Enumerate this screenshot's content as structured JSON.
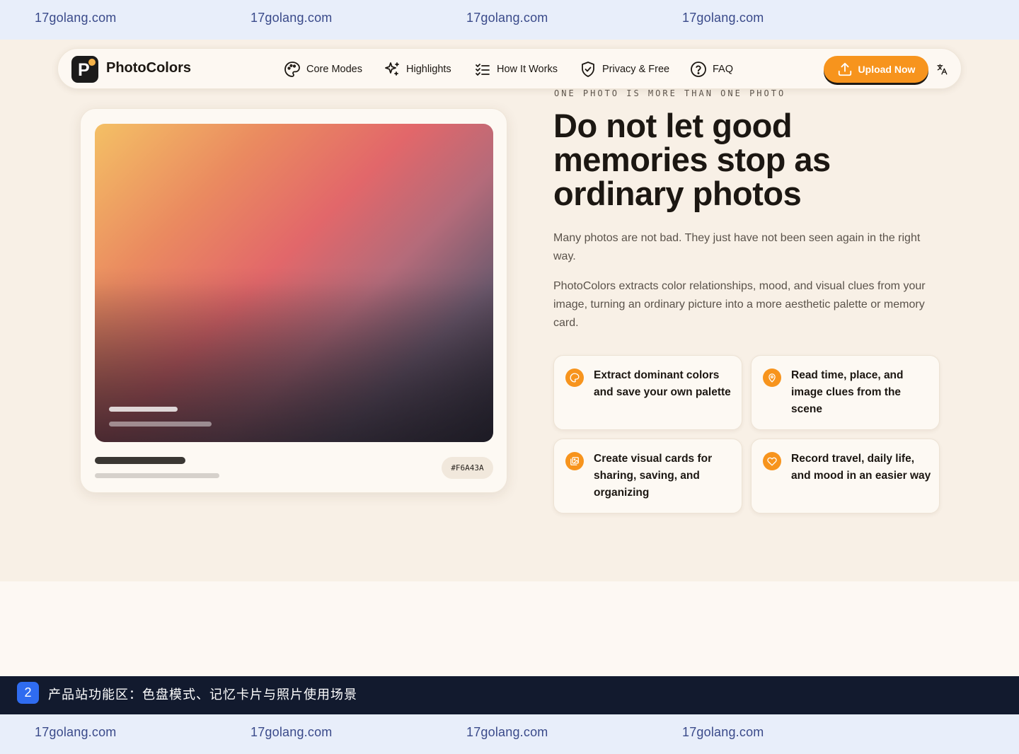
{
  "watermark": {
    "text": "17golang.com"
  },
  "nav": {
    "brand": "PhotoColors",
    "items": [
      {
        "label": "Core Modes",
        "icon": "palette-icon"
      },
      {
        "label": "Highlights",
        "icon": "sparkles-icon"
      },
      {
        "label": "How It Works",
        "icon": "list-checks-icon"
      },
      {
        "label": "Privacy & Free",
        "icon": "shield-check-icon"
      },
      {
        "label": "FAQ",
        "icon": "help-circle-icon"
      }
    ],
    "upload_label": "Upload Now",
    "language_icon": "translate-icon"
  },
  "preview": {
    "hex": "#F6A43A"
  },
  "hero": {
    "eyebrow": "ONE PHOTO IS MORE THAN ONE PHOTO",
    "headline": "Do not let good memories stop as ordinary photos",
    "paragraph1": "Many photos are not bad. They just have not been seen again in the right way.",
    "paragraph2": "PhotoColors extracts color relationships, mood, and visual clues from your image, turning an ordinary picture into a more aesthetic palette or memory card."
  },
  "features": [
    {
      "text": "Extract dominant colors and save your own palette",
      "icon": "palette-icon"
    },
    {
      "text": "Read time, place, and image clues from the scene",
      "icon": "map-pin-icon"
    },
    {
      "text": "Create visual cards for sharing, saving, and organizing",
      "icon": "images-icon"
    },
    {
      "text": "Record travel, daily life, and mood in an easier way",
      "icon": "heart-icon"
    }
  ],
  "footer": {
    "badge": "2",
    "caption": "产品站功能区：色盘模式、记忆卡片与照片使用场景"
  },
  "colors": {
    "accent": "#F7941D",
    "background": "#F8F0E6",
    "footer_bg": "#121A2E",
    "badge_bg": "#2F6CF0"
  }
}
